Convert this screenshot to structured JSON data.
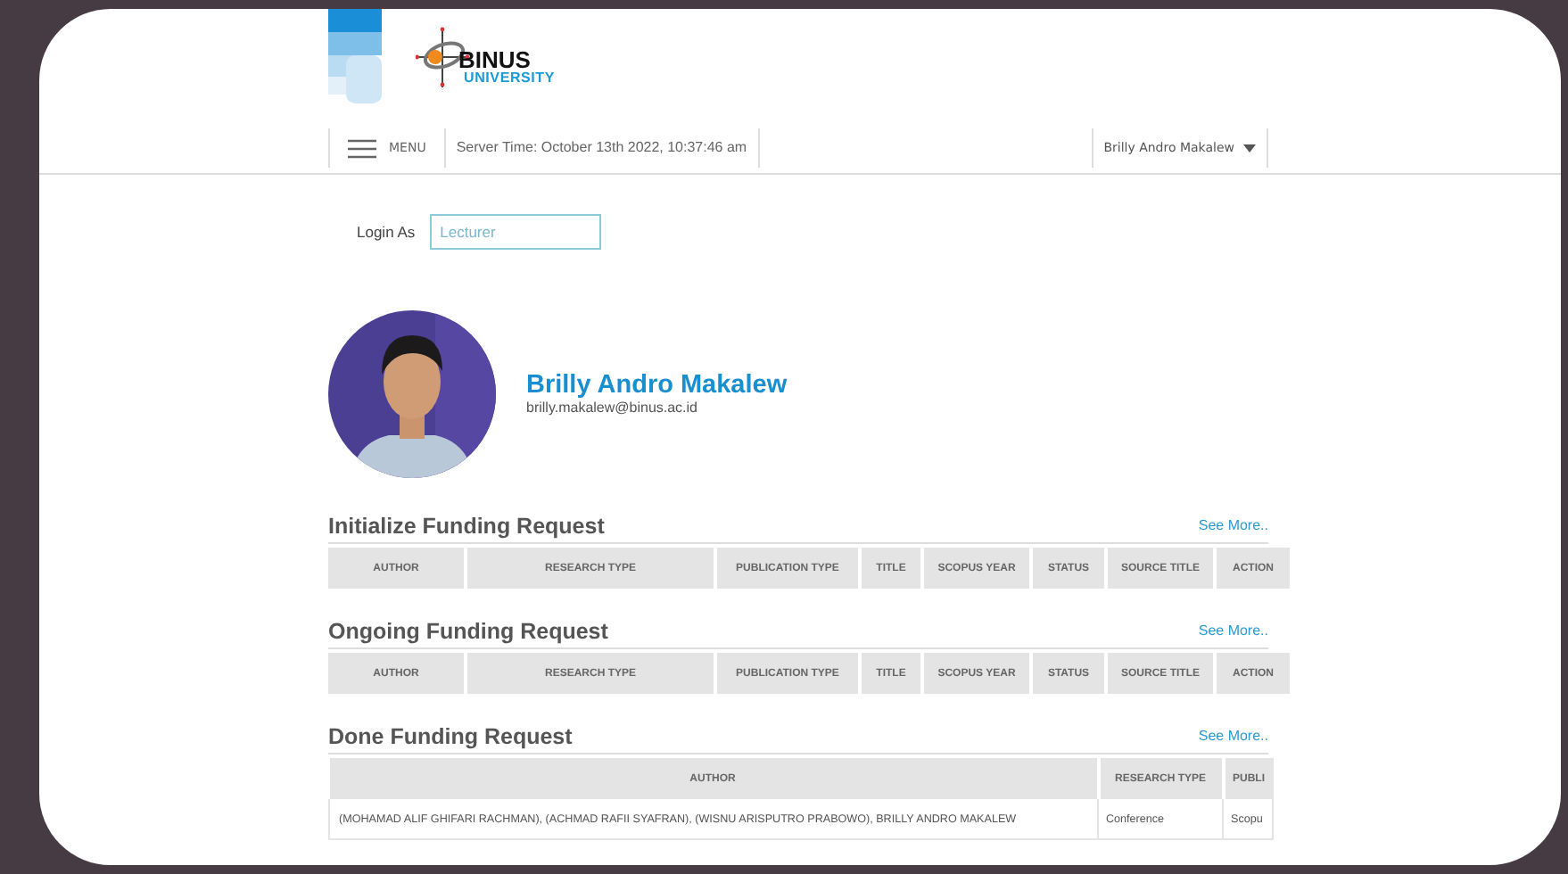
{
  "header": {
    "logo": {
      "wordmark": "BINUS",
      "subtitle": "UNIVERSITY"
    }
  },
  "navbar": {
    "menu_label": "MENU",
    "server_time": "Server Time: October 13th 2022, 10:37:46 am",
    "user_menu": "Brilly Andro Makalew"
  },
  "login_as": {
    "label": "Login As",
    "value": "Lecturer"
  },
  "profile": {
    "name": "Brilly Andro Makalew",
    "email": "brilly.makalew@binus.ac.id"
  },
  "sections": [
    {
      "title": "Initialize Funding Request",
      "see_more": "See More..",
      "columns": [
        "AUTHOR",
        "RESEARCH TYPE",
        "PUBLICATION TYPE",
        "TITLE",
        "SCOPUS YEAR",
        "STATUS",
        "SOURCE TITLE",
        "ACTION"
      ]
    },
    {
      "title": "Ongoing Funding Request",
      "see_more": "See More..",
      "columns": [
        "AUTHOR",
        "RESEARCH TYPE",
        "PUBLICATION TYPE",
        "TITLE",
        "SCOPUS YEAR",
        "STATUS",
        "SOURCE TITLE",
        "ACTION"
      ]
    },
    {
      "title": "Done Funding Request",
      "see_more": "See More..",
      "columns": [
        "AUTHOR",
        "RESEARCH TYPE",
        "PUBLI"
      ],
      "rows": [
        [
          "(MOHAMAD ALIF GHIFARI RACHMAN), (ACHMAD RAFII SYAFRAN), (WISNU ARISPUTRO PRABOWO), BRILLY ANDRO MAKALEW",
          "Conference",
          "Scopu"
        ]
      ]
    }
  ]
}
